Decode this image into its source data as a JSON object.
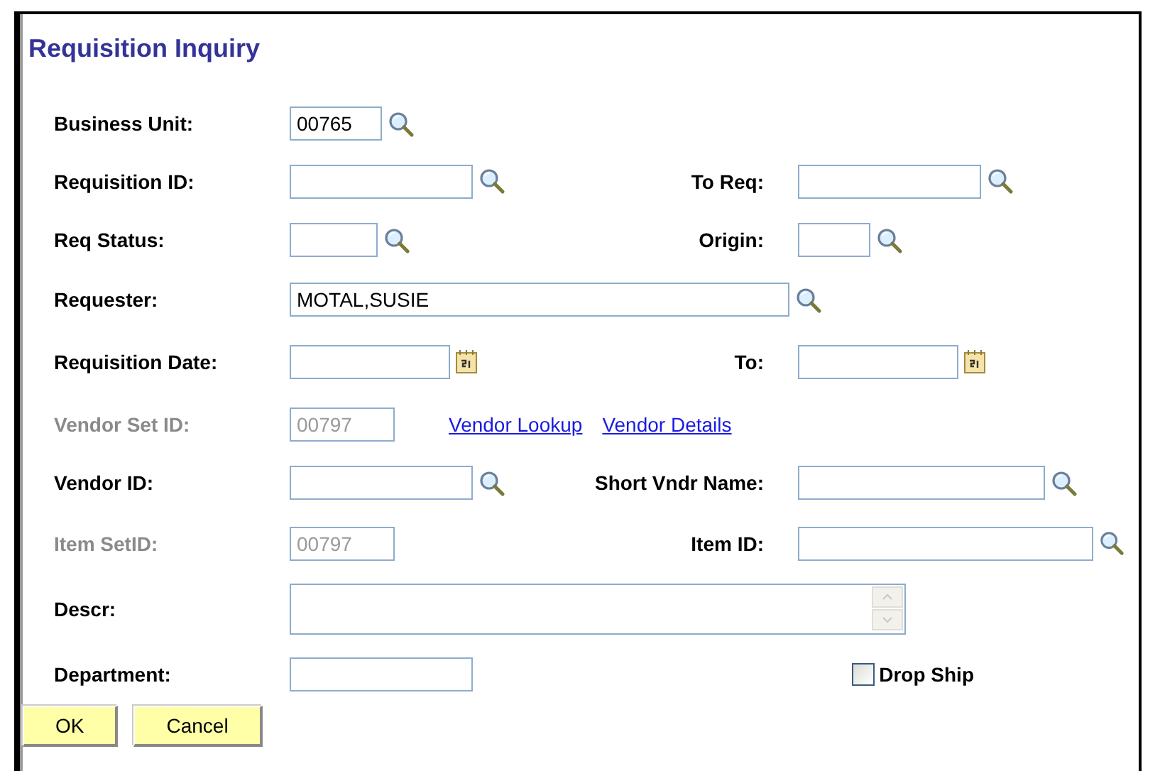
{
  "title": "Requisition Inquiry",
  "fields": [
    {
      "label": "Business Unit:",
      "value": "00765",
      "kind": "lookup",
      "disabled": false
    },
    {
      "label": "Requisition ID:",
      "kind": "lookup",
      "disabled": false
    },
    {
      "label": "To Req:",
      "kind": "lookup",
      "disabled": false
    },
    {
      "label": "Req Status:",
      "kind": "lookup",
      "disabled": false
    },
    {
      "label": "Origin:",
      "kind": "lookup",
      "disabled": false
    },
    {
      "label": "Requester:",
      "value": "MOTAL,SUSIE",
      "kind": "lookup",
      "disabled": false
    },
    {
      "label": "Requisition Date:",
      "kind": "date",
      "disabled": false
    },
    {
      "label": "To:",
      "kind": "date",
      "disabled": false
    },
    {
      "label": "Vendor Set ID:",
      "value": "00797",
      "kind": "text",
      "disabled": true
    },
    {
      "label": "Vendor ID:",
      "kind": "lookup",
      "disabled": false
    },
    {
      "label": "Short Vndr Name:",
      "kind": "lookup",
      "disabled": false
    },
    {
      "label": "Item SetID:",
      "value": "00797",
      "kind": "text",
      "disabled": true
    },
    {
      "label": "Item ID:",
      "kind": "lookup",
      "disabled": false
    },
    {
      "label": "Descr:",
      "kind": "textarea",
      "disabled": false
    },
    {
      "label": "Department:",
      "kind": "text",
      "disabled": false
    }
  ],
  "links": [
    "Vendor Lookup",
    "Vendor Details"
  ],
  "drop_ship": {
    "label": "Drop Ship",
    "checked": false
  },
  "buttons": [
    "OK",
    "Cancel"
  ]
}
